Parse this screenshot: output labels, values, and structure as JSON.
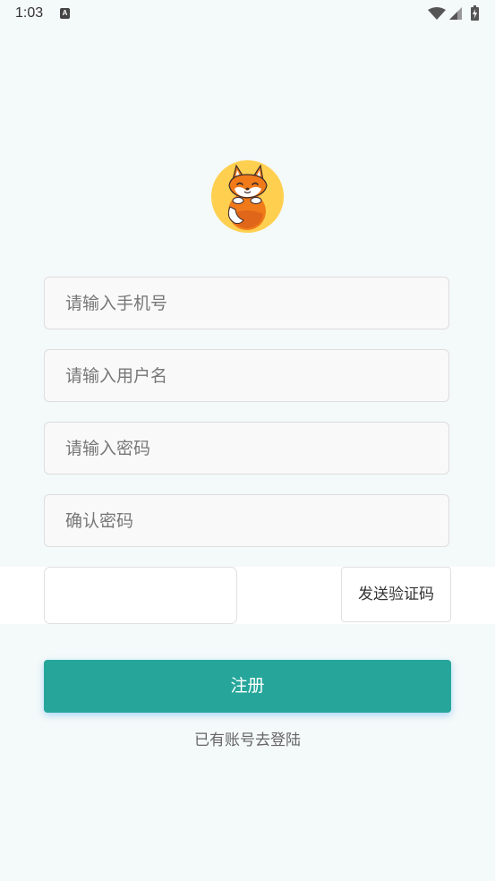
{
  "status_bar": {
    "time": "1:03",
    "a_icon_letter": "A",
    "icons": [
      "a-notification-icon",
      "wifi-icon",
      "signal-icon",
      "battery-icon"
    ]
  },
  "logo": {
    "icon": "fox-mascot-logo",
    "background_color": "#ffd050"
  },
  "form": {
    "phone_placeholder": "请输入手机号",
    "username_placeholder": "请输入用户名",
    "password_placeholder": "请输入密码",
    "confirm_placeholder": "确认密码",
    "code_value": "",
    "send_code_label": "发送验证码"
  },
  "actions": {
    "register_label": "注册",
    "login_link": "已有账号去登陆"
  },
  "colors": {
    "accent": "#26a69a",
    "page_background": "#f4f9f9"
  }
}
